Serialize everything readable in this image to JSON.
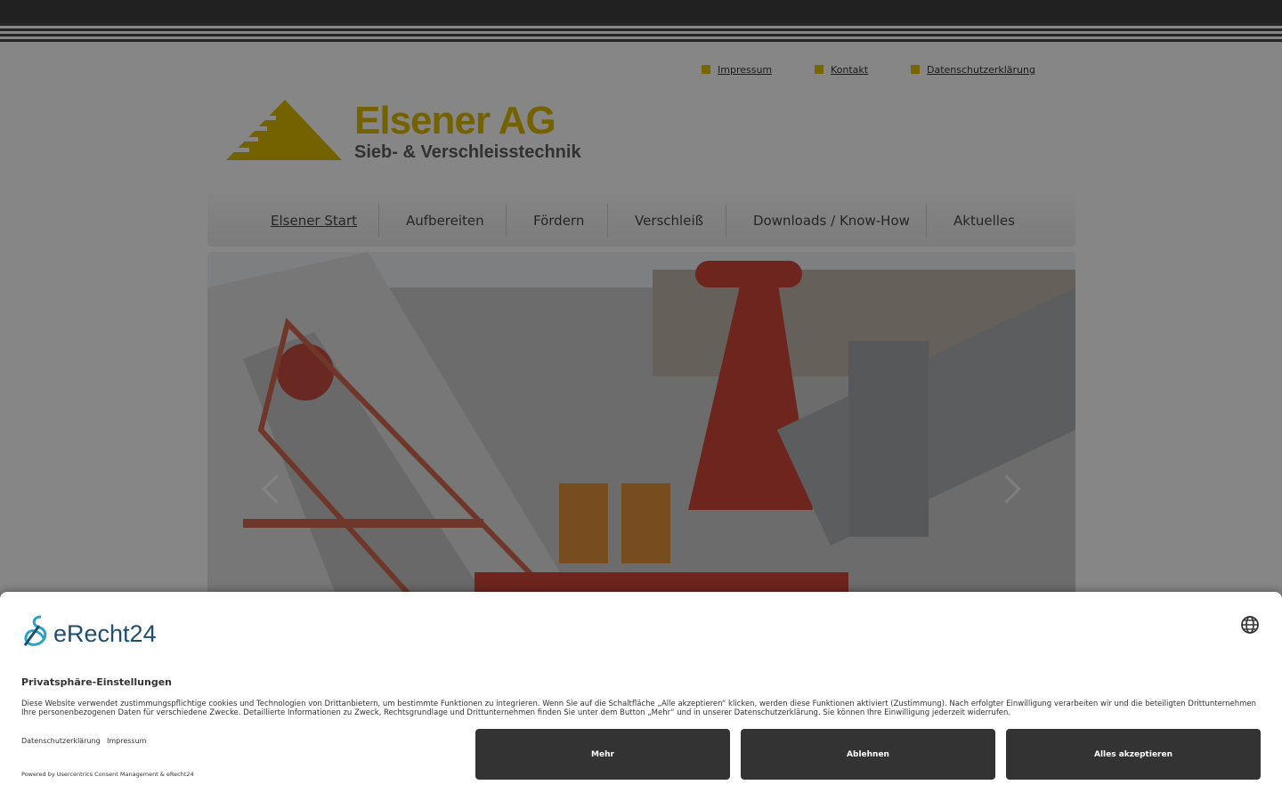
{
  "header": {
    "top_links": [
      "Impressum",
      "Kontakt",
      "Datenschutzerklärung"
    ]
  },
  "logo": {
    "title": "Elsener AG",
    "subtitle": "Sieb- & Verschleisstechnik"
  },
  "nav": {
    "items": [
      "Elsener Start",
      "Aufbereiten",
      "Fördern",
      "Verschleiß",
      "Downloads / Know-How",
      "Aktuelles"
    ],
    "active": "Elsener Start"
  },
  "colors": {
    "brand_yellow": "#d4b300",
    "dark": "#333333"
  },
  "consent": {
    "brand": "eRecht24",
    "title": "Privatsphäre-Einstellungen",
    "text": "Diese Website verwendet zustimmungspflichtige cookies und Technologien von Drittanbietern, um bestimmte Funktionen zu integrieren. Wenn Sie auf die Schaltfläche „Alle akzeptieren“ klicken, werden diese Funktionen aktiviert (Zustimmung). Nach erfolgter Einwilligung verarbeiten wir und die beteiligten Drittunternehmen Ihre personenbezogenen Daten für verschiedene Zwecke. Detaillierte Informationen zu Zweck, Rechtsgrundlage und Drittunternehmen finden Sie unter dem Button „Mehr“ und in unserer Datenschutzerklärung. Sie können Ihre Einwilligung jederzeit widerrufen.",
    "links": [
      "Datenschutzerklärung",
      "Impressum"
    ],
    "powered": "Powered by Usercentrics Consent Management & eRecht24",
    "buttons": {
      "more": "Mehr",
      "decline": "Ablehnen",
      "accept_all": "Alles akzeptieren"
    }
  }
}
